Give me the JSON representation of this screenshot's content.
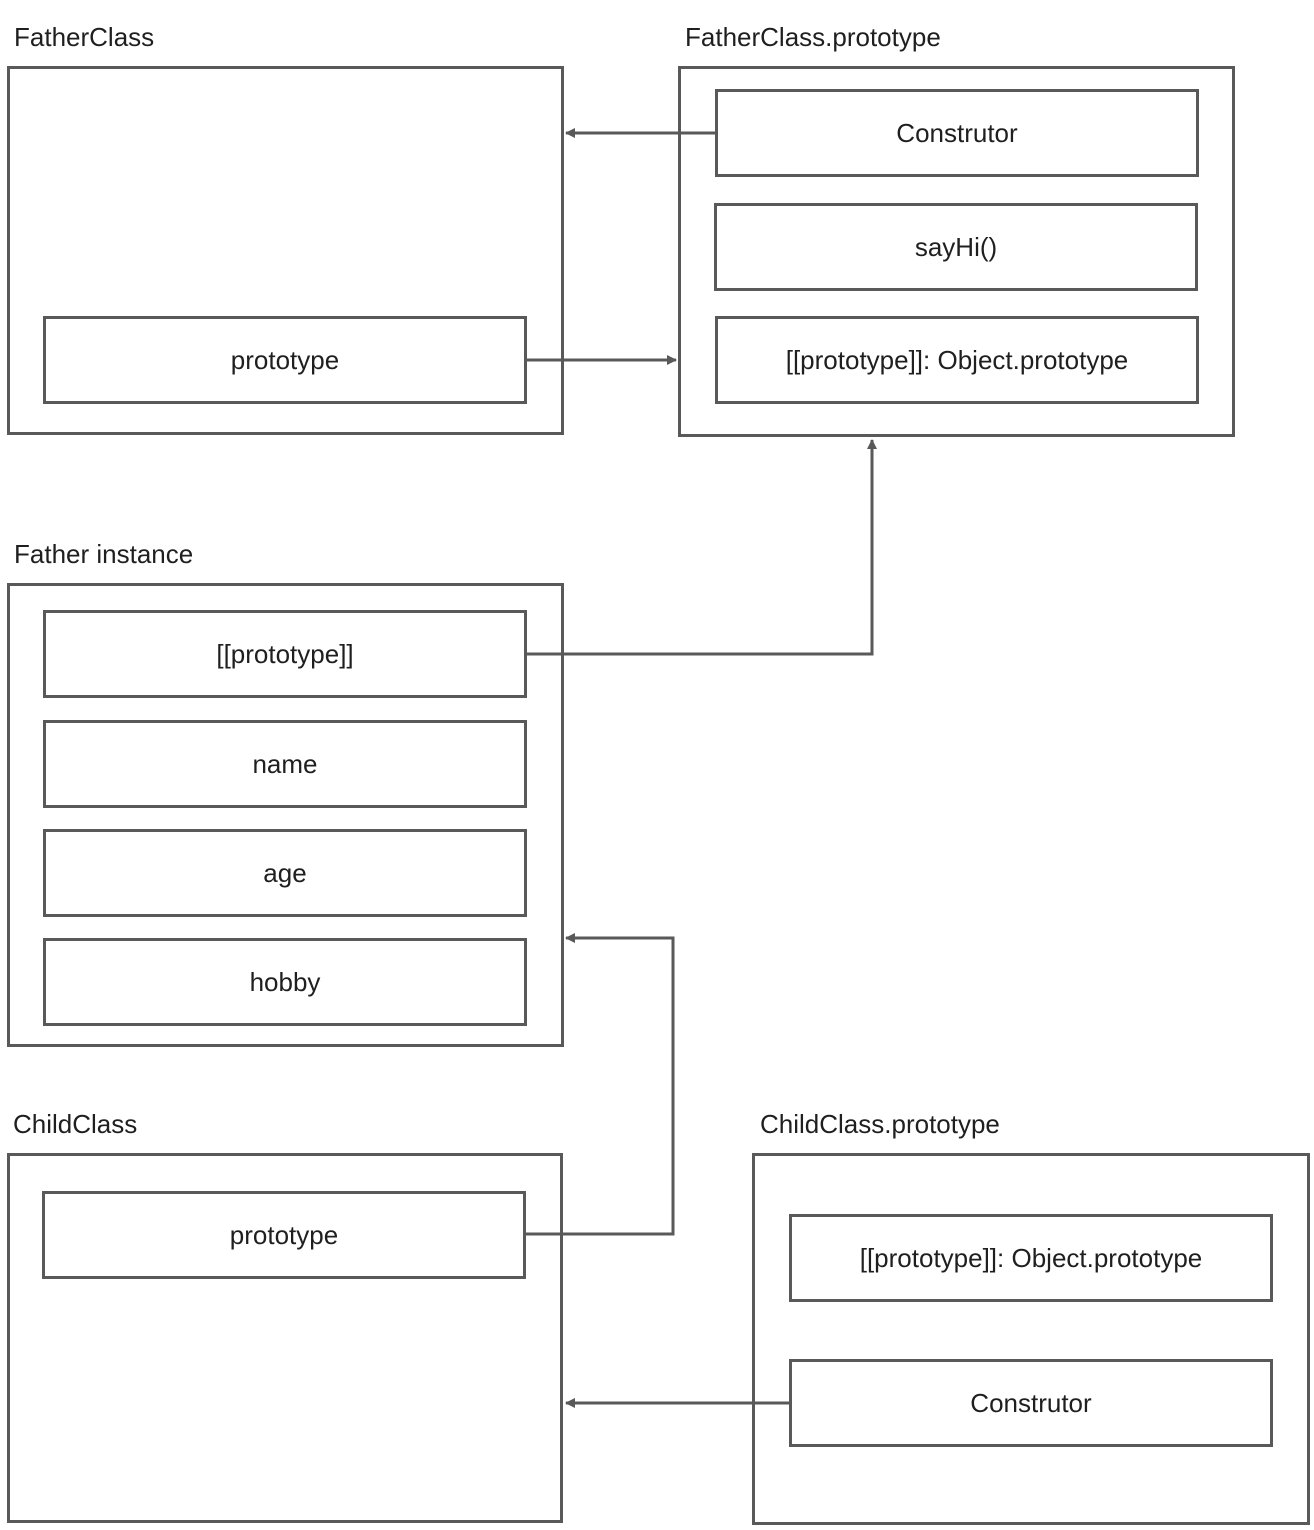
{
  "diagram": {
    "nodes": {
      "father_class": {
        "title": "FatherClass",
        "fields": [
          "prototype"
        ]
      },
      "father_proto": {
        "title": "FatherClass.prototype",
        "fields": [
          "Construtor",
          "sayHi()",
          "[[prototype]]: Object.prototype"
        ]
      },
      "father_instance": {
        "title": "Father instance",
        "fields": [
          "[[prototype]]",
          "name",
          "age",
          "hobby"
        ]
      },
      "child_class": {
        "title": "ChildClass",
        "fields": [
          "prototype"
        ]
      },
      "child_proto": {
        "title": "ChildClass.prototype",
        "fields": [
          "[[prototype]]: Object.prototype",
          "Construtor"
        ]
      }
    },
    "edges": [
      {
        "from": "FatherClass.prototype.Construtor",
        "to": "FatherClass"
      },
      {
        "from": "FatherClass.prototype (field)",
        "to": "FatherClass.prototype"
      },
      {
        "from": "Father instance.[[prototype]]",
        "to": "FatherClass.prototype"
      },
      {
        "from": "ChildClass.prototype (field)",
        "to": "Father instance"
      },
      {
        "from": "ChildClass.prototype.Construtor",
        "to": "ChildClass"
      }
    ],
    "stroke_color": "#595959"
  }
}
